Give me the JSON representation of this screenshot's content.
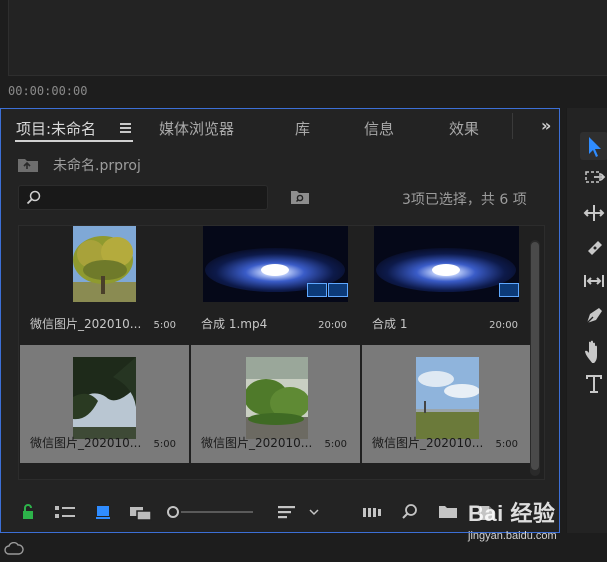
{
  "monitor": {
    "timecode": "00:00:00:00"
  },
  "project_panel": {
    "tabs": [
      {
        "label": "项目:未命名"
      },
      {
        "label": "媒体浏览器"
      },
      {
        "label": "库"
      },
      {
        "label": "信息"
      },
      {
        "label": "效果"
      }
    ],
    "project_file": "未命名.prproj",
    "search": {
      "placeholder": "",
      "value": ""
    },
    "selection_info": "3项已选择，共 6 项",
    "items": [
      {
        "name": "微信图片_202010...",
        "duration": "5:00",
        "selected": false,
        "kind": "image-trees"
      },
      {
        "name": "合成 1.mp4",
        "duration": "20:00",
        "selected": false,
        "kind": "video-galaxy"
      },
      {
        "name": "合成 1",
        "duration": "20:00",
        "selected": false,
        "kind": "sequence-galaxy"
      },
      {
        "name": "微信图片_202010...",
        "duration": "5:00",
        "selected": true,
        "kind": "image-leaves"
      },
      {
        "name": "微信图片_202010...",
        "duration": "5:00",
        "selected": true,
        "kind": "image-plants"
      },
      {
        "name": "微信图片_202010...",
        "duration": "5:00",
        "selected": true,
        "kind": "image-sky"
      }
    ]
  },
  "tools_panel": {
    "tools": [
      "selection-tool",
      "track-select-tool",
      "ripple-edit-tool",
      "razor-tool",
      "slip-tool",
      "pen-tool",
      "hand-tool",
      "type-tool"
    ]
  },
  "watermark": {
    "brand": "Bai 经验",
    "url": "jingyan.baidu.com"
  },
  "colors": {
    "accent": "#3c6fd6",
    "tool_active": "#2f8cff",
    "selected_tile": "#7a7a7a",
    "lock_green": "#2db34a"
  }
}
